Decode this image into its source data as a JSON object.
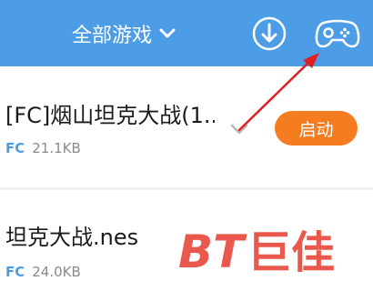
{
  "header": {
    "title": "全部游戏",
    "download_icon": "download-circle-icon",
    "gamepad_icon": "gamepad-icon",
    "background": "#4d9de6"
  },
  "games": [
    {
      "title": "[FC]烟山坦克大战(1...",
      "platform": "FC",
      "size": "21.1KB",
      "action_label": "启动"
    },
    {
      "title": "坦克大战.nes",
      "platform": "FC",
      "size": "24.0KB"
    }
  ],
  "colors": {
    "accent": "#4d9de6",
    "button": "#f57c1f",
    "arrow": "#e02020"
  },
  "watermark": {
    "text": "BT巨佳"
  }
}
